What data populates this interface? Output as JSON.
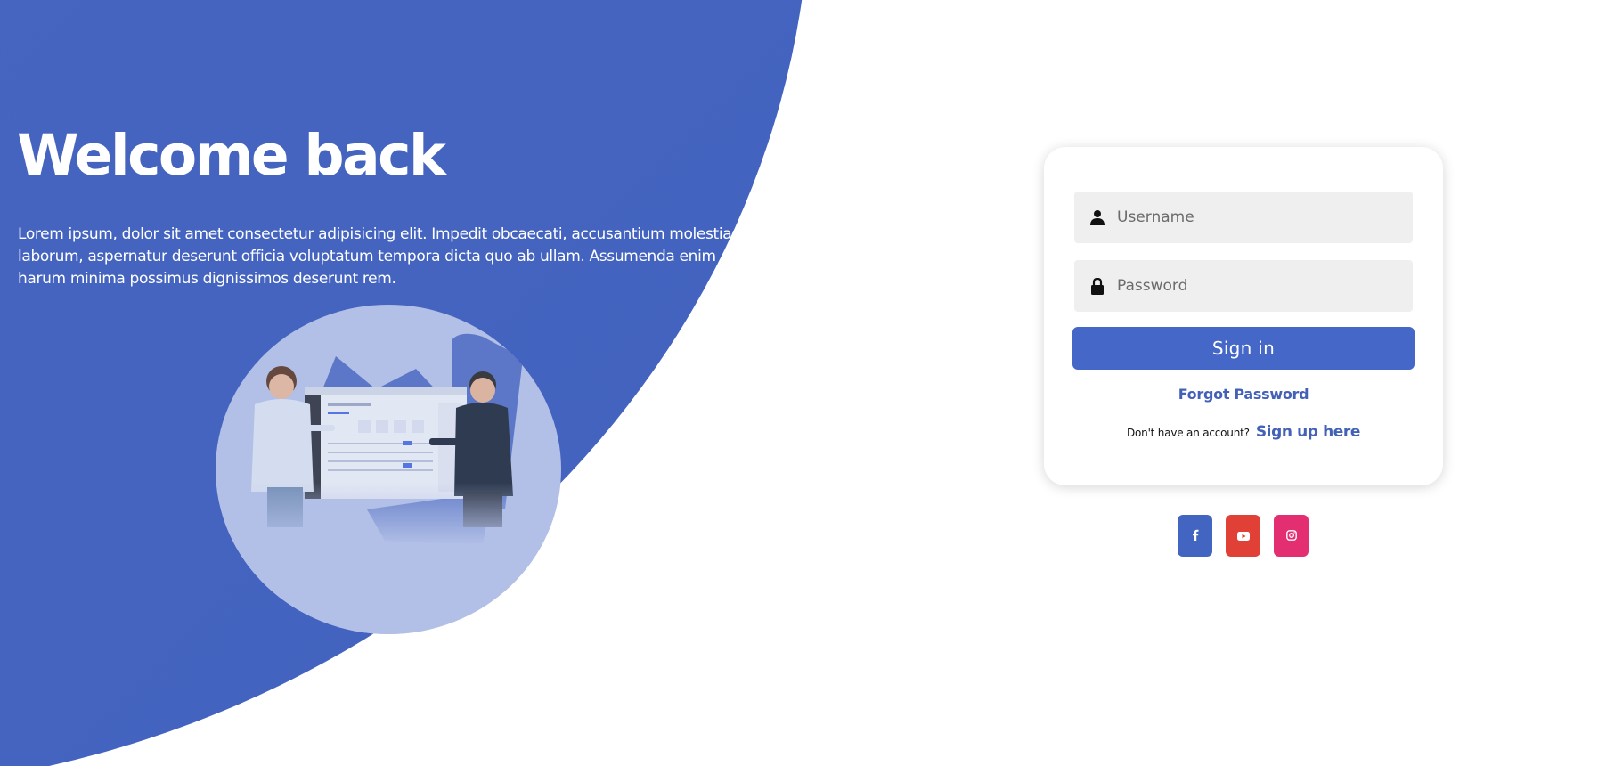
{
  "hero": {
    "title": "Welcome back",
    "description": "Lorem ipsum, dolor sit amet consectetur adipisicing elit. Impedit obcaecati, accusantium molestias, laborum, aspernatur deserunt officia voluptatum tempora dicta quo ab ullam. Assumenda enim harum minima possimus dignissimos deserunt rem."
  },
  "login": {
    "username_placeholder": "Username",
    "password_placeholder": "Password",
    "signin_label": "Sign in",
    "forgot_label": "Forgot Password",
    "no_account_text": "Don't have an account?",
    "signup_label": "Sign up here"
  },
  "social": [
    {
      "name": "facebook-icon",
      "color": "#4165c0"
    },
    {
      "name": "youtube-icon",
      "color": "#e04036"
    },
    {
      "name": "instagram-icon",
      "color": "#e42e72"
    }
  ],
  "colors": {
    "brand_blue": "#4262bf",
    "link_blue": "#4461b8",
    "field_bg": "#efefef"
  }
}
